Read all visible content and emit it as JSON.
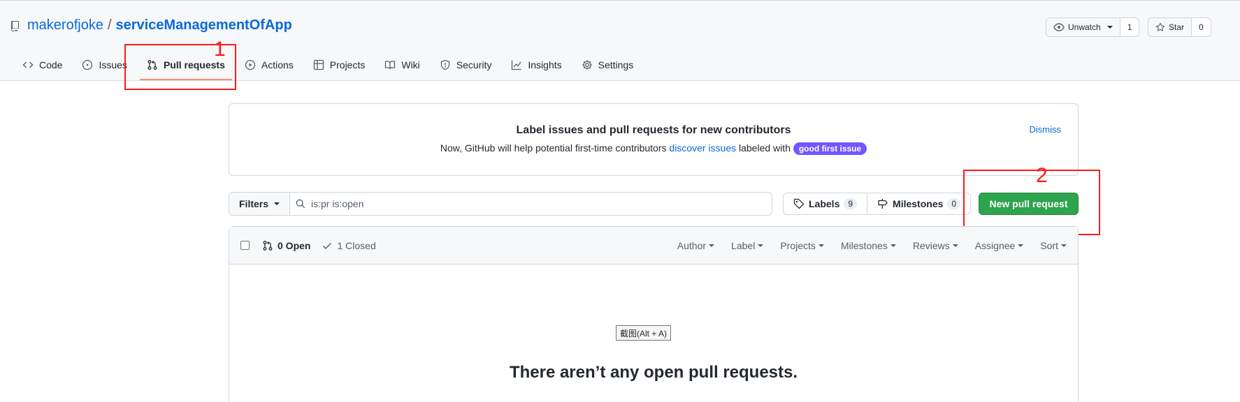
{
  "repo": {
    "owner": "makerofjoke",
    "separator": "/",
    "name": "serviceManagementOfApp"
  },
  "header_buttons": {
    "unwatch": {
      "label": "Unwatch",
      "count": "1"
    },
    "star": {
      "label": "Star",
      "count": "0"
    }
  },
  "tabs": [
    {
      "label": "Code",
      "icon": "code-icon"
    },
    {
      "label": "Issues",
      "icon": "issue-icon"
    },
    {
      "label": "Pull requests",
      "icon": "pull-request-icon",
      "selected": true
    },
    {
      "label": "Actions",
      "icon": "play-icon"
    },
    {
      "label": "Projects",
      "icon": "table-icon"
    },
    {
      "label": "Wiki",
      "icon": "book-icon"
    },
    {
      "label": "Security",
      "icon": "shield-icon"
    },
    {
      "label": "Insights",
      "icon": "graph-icon"
    },
    {
      "label": "Settings",
      "icon": "gear-icon"
    }
  ],
  "annotations": {
    "one": "1",
    "two": "2"
  },
  "banner": {
    "title": "Label issues and pull requests for new contributors",
    "desc_before": "Now, GitHub will help potential first-time contributors ",
    "desc_link": "discover issues",
    "desc_after": " labeled with ",
    "label": "good first issue",
    "dismiss": "Dismiss"
  },
  "filters": {
    "button": "Filters",
    "query": "is:pr is:open"
  },
  "labels": {
    "label": "Labels",
    "count": "9"
  },
  "milestones": {
    "label": "Milestones",
    "count": "0"
  },
  "new_pr": "New pull request",
  "list": {
    "open": "0 Open",
    "closed": "1 Closed",
    "sorters": [
      "Author",
      "Label",
      "Projects",
      "Milestones",
      "Reviews",
      "Assignee",
      "Sort"
    ]
  },
  "tooltip": "截图(Alt + A)",
  "blank_title": "There aren’t any open pull requests.",
  "colors": {
    "accent": "#0969da",
    "primary_button": "#2da44e",
    "tab_underline": "#fd8c73",
    "annotation": "#ff1a1a",
    "label_purple": "#7057ff"
  }
}
